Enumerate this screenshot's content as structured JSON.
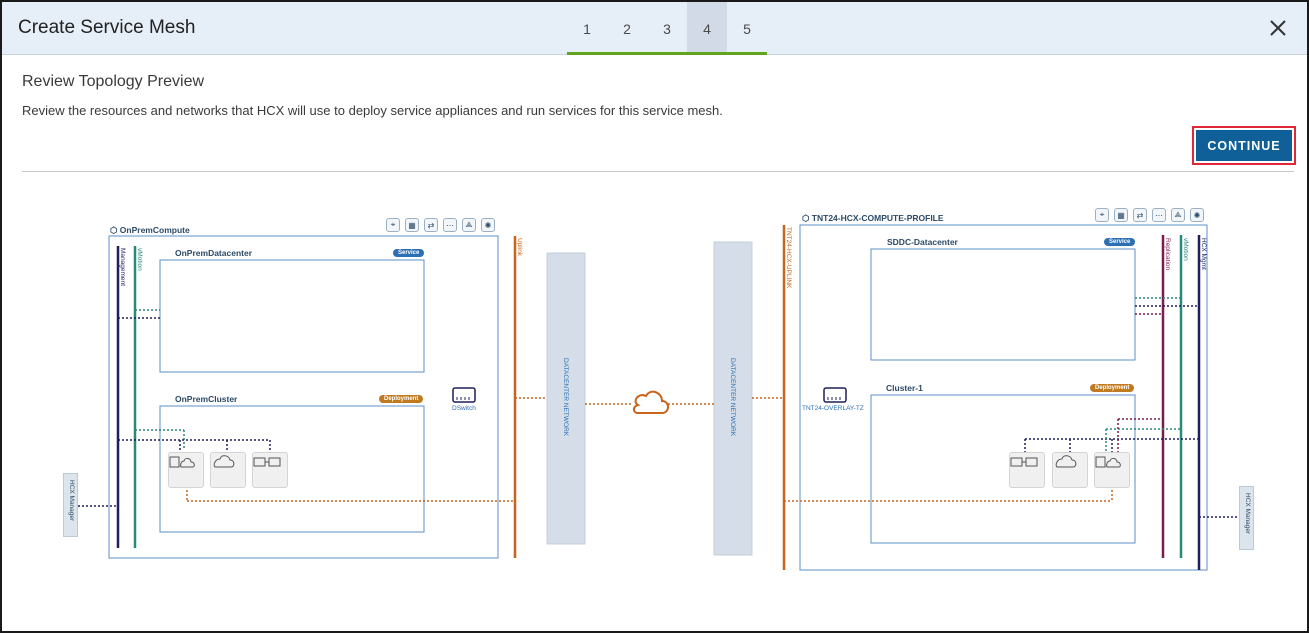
{
  "header": {
    "title": "Create Service Mesh",
    "steps": [
      "1",
      "2",
      "3",
      "4",
      "5"
    ],
    "active_step": "4",
    "close_icon": "close-icon"
  },
  "main": {
    "section_title": "Review Topology Preview",
    "description": "Review the resources and networks that HCX will use to deploy service appliances and run services for this service mesh.",
    "continue_label": "CONTINUE"
  },
  "topology": {
    "left": {
      "compute_profile": "OnPremCompute",
      "datacenter": "OnPremDatacenter",
      "datacenter_badge": "Service",
      "cluster": "OnPremCluster",
      "cluster_badge": "Deployment",
      "switch_label": "DSwitch",
      "hcx_manager": "HCX Manager",
      "networks": [
        "Management",
        "vMotion"
      ],
      "uplink": "Uplink"
    },
    "center": {
      "left_network": "DATACENTER NETWORK",
      "right_network": "DATACENTER NETWORK",
      "cloud_icon": "cloud-icon"
    },
    "right": {
      "compute_profile": "TNT24-HCX-COMPUTE-PROFILE",
      "datacenter": "SDDC-Datacenter",
      "datacenter_badge": "Service",
      "cluster": "Cluster-1",
      "cluster_badge": "Deployment",
      "switch_label": "TNT24-OVERLAY-TZ",
      "hcx_manager": "HCX Manager",
      "uplink": "TNT24-HCX-UPLINK",
      "networks": [
        "Replication",
        "vMotion",
        "HCX Mgmt"
      ]
    },
    "colors": {
      "management": "#1f1f5c",
      "vmotion": "#2a8a78",
      "uplink": "#c8641b",
      "replication": "#7a1d4d",
      "cloud": "#c8641b",
      "box_border": "#5b8fc9"
    }
  }
}
